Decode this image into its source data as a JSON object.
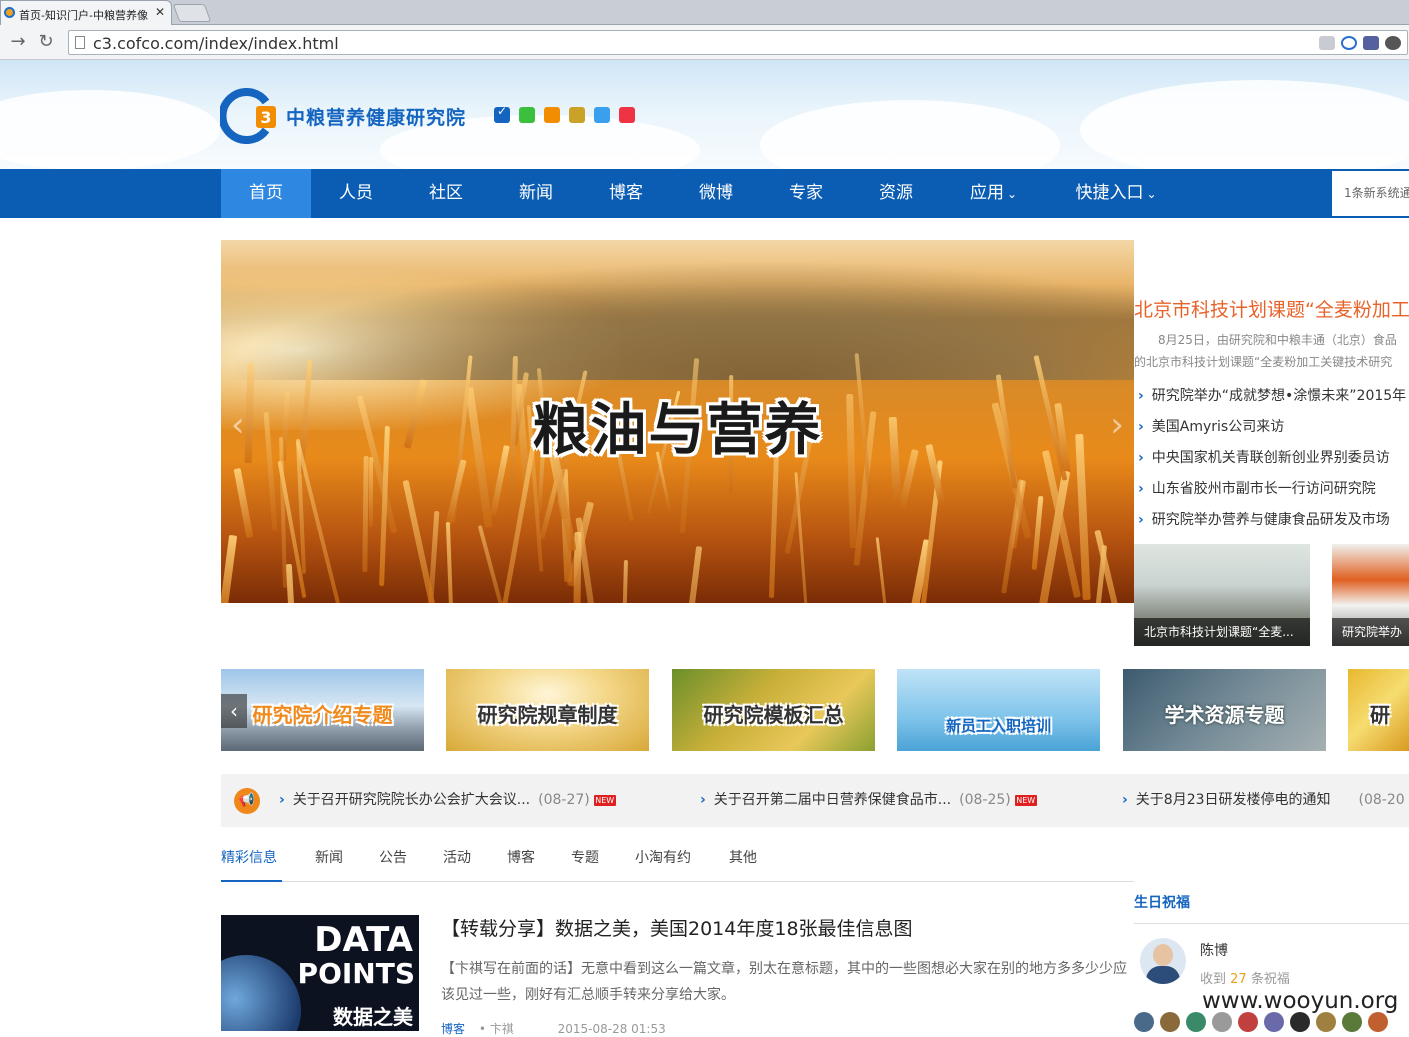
{
  "browser": {
    "tab_title": "首页-知识门户-中粮营养像",
    "url": "c3.cofco.com/index/index.html"
  },
  "header": {
    "site_title": "中粮营养健康研究院",
    "swatch_colors": [
      "#1565c0",
      "#3cbf3c",
      "#f28c00",
      "#c9a227",
      "#3aa0ee",
      "#ee3344"
    ]
  },
  "nav": {
    "items": [
      "首页",
      "人员",
      "社区",
      "新闻",
      "博客",
      "微博",
      "专家",
      "资源",
      "应用",
      "快捷入口"
    ],
    "notice": "1条新系统通"
  },
  "hero": {
    "title": "粮油与营养"
  },
  "news": {
    "headline": "北京市科技计划课题“全麦粉加工",
    "summary_1": "8月25日，由研究院和中粮丰通（北京）食品",
    "summary_2": "的北京市科技计划课题“全麦粉加工关键技术研究",
    "items": [
      "研究院举办“成就梦想•涂憬未来”2015年",
      "美国Amyris公司来访",
      "中央国家机关青联创新创业界别委员访",
      "山东省胶州市副市长一行访问研究院",
      "研究院举办营养与健康食品研发及市场"
    ],
    "thumbs": [
      "北京市科技计划课题“全麦...",
      "研究院举办"
    ]
  },
  "banners": [
    "研究院介绍专题",
    "研究院规章制度",
    "研究院模板汇总",
    "新员工入职培训",
    "学术资源专题",
    "研"
  ],
  "notices": [
    {
      "title": "关于召开研究院院长办公会扩大会议...",
      "date": "(08-27)"
    },
    {
      "title": "关于召开第二届中日营养保健食品市...",
      "date": "(08-25)"
    },
    {
      "title": "关于8月23日研发楼停电的通知",
      "date": "(08-20"
    }
  ],
  "new_badge": "NEW",
  "tabs": [
    "精彩信息",
    "新闻",
    "公告",
    "活动",
    "博客",
    "专题",
    "小淘有约",
    "其他"
  ],
  "article": {
    "title": "【转载分享】数据之美，美国2014年度18张最佳信息图",
    "body": "【卞祺写在前面的话】无意中看到这么一篇文章，别太在意标题，其中的一些图想必大家在别的地方多多少少应该见过一些，刚好有汇总顺手转来分享给大家。",
    "category": "博客",
    "author": "卞祺",
    "time": "2015-08-28 01:53",
    "img_text_1": "DATA",
    "img_text_2": "POINTS",
    "img_text_3": "数据之美"
  },
  "birthday": {
    "title": "生日祝福",
    "name": "陈博",
    "count_prefix": "收到",
    "count": "27",
    "count_suffix": "条祝福"
  },
  "watermark": "www.wooyun.org"
}
